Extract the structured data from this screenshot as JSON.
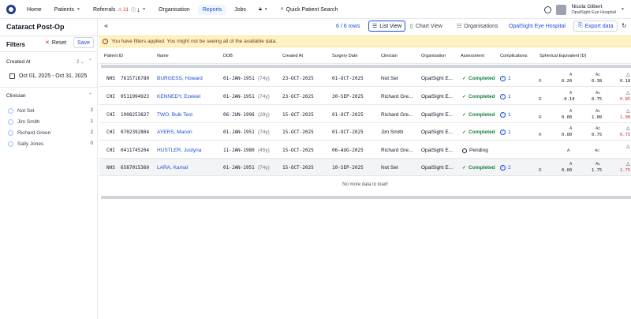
{
  "nav": {
    "items": [
      {
        "label": "Home",
        "active": false
      },
      {
        "label": "Patients",
        "active": false,
        "dropdown": true
      },
      {
        "label": "Referrals",
        "active": false,
        "dropdown": true,
        "badge_red": "21",
        "badge_gray": "1"
      },
      {
        "label": "Organisation",
        "active": false
      },
      {
        "label": "Reports",
        "active": true
      },
      {
        "label": "Jobs",
        "active": false
      }
    ],
    "search_label": "Quick Patient Search",
    "user_name": "Nicola Gilbert",
    "user_org": "OpalSight Eye Hospital"
  },
  "left": {
    "page_title": "Cataract Post-Op",
    "filters_title": "Filters",
    "reset_label": "Reset",
    "save_label": "Save",
    "created_at_label": "Created At",
    "created_at_sort": "2",
    "date_range": "Oct 01, 2025 - Oct 31, 2025",
    "clinician_label": "Clinician",
    "clinicians": [
      {
        "name": "Not Set",
        "count": "2"
      },
      {
        "name": "Jim Smith",
        "count": "1"
      },
      {
        "name": "Richard Green",
        "count": "2"
      },
      {
        "name": "Sally Jones",
        "count": "0"
      }
    ]
  },
  "toolbar": {
    "rows": "6 / 6 rows",
    "list_view": "List View",
    "chart_view": "Chart View",
    "organisations": "Organisations",
    "org_link": "OpalSight Eye Hospital",
    "export": "Export data"
  },
  "warning": "You have filters applied. You might not be seeing all of the available data.",
  "columns": [
    "Patient ID",
    "Name",
    "DOB",
    "Created At",
    "Surgery Date",
    "Clinician",
    "Organisation",
    "Assessment",
    "Complications",
    "Spherical Equivalent (D)"
  ],
  "rows": [
    {
      "id_type": "NHS",
      "id": "7615716780",
      "name": "BURGESS, Howard",
      "dob": "01-JAN-1951",
      "age": "(74y)",
      "created": "23-OCT-2025",
      "surgery": "01-OCT-2025",
      "clinician": "Not Set",
      "org": "OpalSight E...",
      "assessment": "Completed",
      "status": "done",
      "complications": "1",
      "se_a": "0.20",
      "se_ac": "0.38",
      "se_r": "0.18",
      "se_r_red": false
    },
    {
      "id_type": "CHI",
      "id": "0511994923",
      "name": "KENNEDY, Ezekiel",
      "dob": "01-JAN-1951",
      "age": "(74y)",
      "created": "23-OCT-2025",
      "surgery": "30-SEP-2025",
      "clinician": "Richard Gre...",
      "org": "OpalSight E...",
      "assessment": "Completed",
      "status": "done",
      "complications": "1",
      "se_a": "-0.10",
      "se_ac": "0.75",
      "se_r": "0.85",
      "se_r_red": true
    },
    {
      "id_type": "CHI",
      "id": "1908253827",
      "name": "TWO, Bulk Test",
      "dob": "06-JUN-1996",
      "age": "(29y)",
      "created": "15-OCT-2025",
      "surgery": "01-OCT-2025",
      "clinician": "Richard Gre...",
      "org": "OpalSight E...",
      "assessment": "Completed",
      "status": "done",
      "complications": "1",
      "se_a": "0.00",
      "se_ac": "1.00",
      "se_r": "1.00",
      "se_r_red": true
    },
    {
      "id_type": "CHI",
      "id": "0702392804",
      "name": "AYERS, Marvin",
      "dob": "01-JAN-1951",
      "age": "(74y)",
      "created": "15-OCT-2025",
      "surgery": "01-OCT-2025",
      "clinician": "Jim Smith",
      "org": "OpalSight E...",
      "assessment": "Completed",
      "status": "done",
      "complications": "1",
      "se_a": "0.00",
      "se_ac": "0.75",
      "se_r": "0.75",
      "se_r_red": true
    },
    {
      "id_type": "CHI",
      "id": "0411745204",
      "name": "HUSTLER, Justyna",
      "dob": "11-JAN-1980",
      "age": "(45y)",
      "created": "15-OCT-2025",
      "surgery": "06-AUG-2025",
      "clinician": "Richard Gre...",
      "org": "OpalSight E...",
      "assessment": "Pending",
      "status": "pending",
      "complications": "",
      "se_a": "",
      "se_ac": "",
      "se_r": "",
      "se_r_red": false
    },
    {
      "id_type": "NHS",
      "id": "6587015360",
      "name": "LARA, Kamal",
      "dob": "01-JAN-1951",
      "age": "(74y)",
      "created": "15-OCT-2025",
      "surgery": "10-SEP-2025",
      "clinician": "Not Set",
      "org": "OpalSight E...",
      "assessment": "Completed",
      "status": "done",
      "complications": "2",
      "se_a": "0.00",
      "se_ac": "1.75",
      "se_r": "1.75",
      "se_r_red": true
    }
  ],
  "se_labels": {
    "a": "A",
    "ac": "Ac",
    "r": "R"
  },
  "no_more": "No more data to load!"
}
